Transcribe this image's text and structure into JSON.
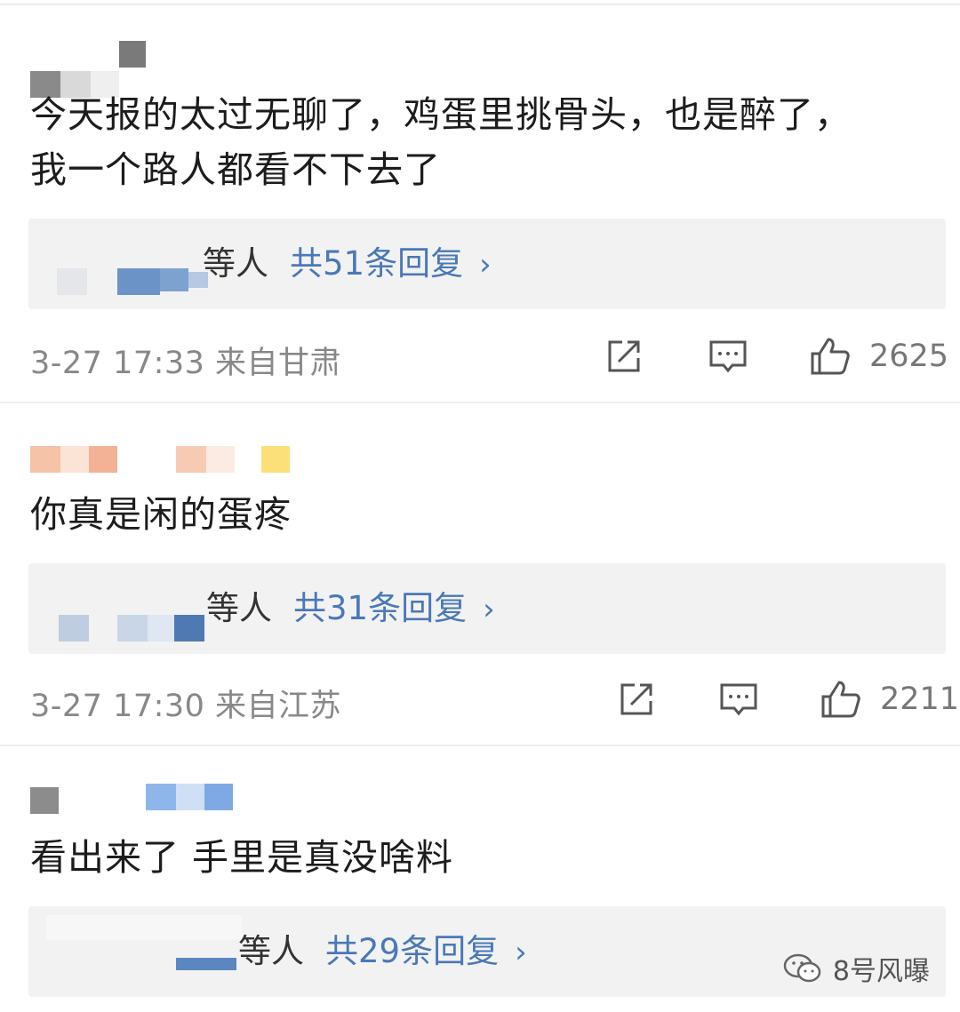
{
  "comments": [
    {
      "text": "今天报的太过无聊了，鸡蛋里挑骨头，也是醉了，\n我一个路人都看不下去了",
      "reply_people": "等人",
      "reply_count": "共51条回复",
      "reply_chevron": "›",
      "time_location": "3-27 17:33 来自甘肃",
      "likes": "2625"
    },
    {
      "text": "你真是闲的蛋疼",
      "reply_people": "等人",
      "reply_count": "共31条回复",
      "reply_chevron": "›",
      "time_location": "3-27 17:30 来自江苏",
      "likes": "2211"
    },
    {
      "text": "看出来了 手里是真没啥料",
      "reply_people": "等人",
      "reply_count": "共29条回复",
      "reply_chevron": "›"
    }
  ],
  "icons": {
    "share": "share-icon",
    "comment": "comment-icon",
    "like": "thumbs-up-icon",
    "watermark": "wechat-icon"
  },
  "colors": {
    "link_blue": "#4a78b8",
    "meta_gray": "#888888",
    "reply_bg": "#f2f2f2"
  },
  "watermark": {
    "text": "8号风曝"
  }
}
